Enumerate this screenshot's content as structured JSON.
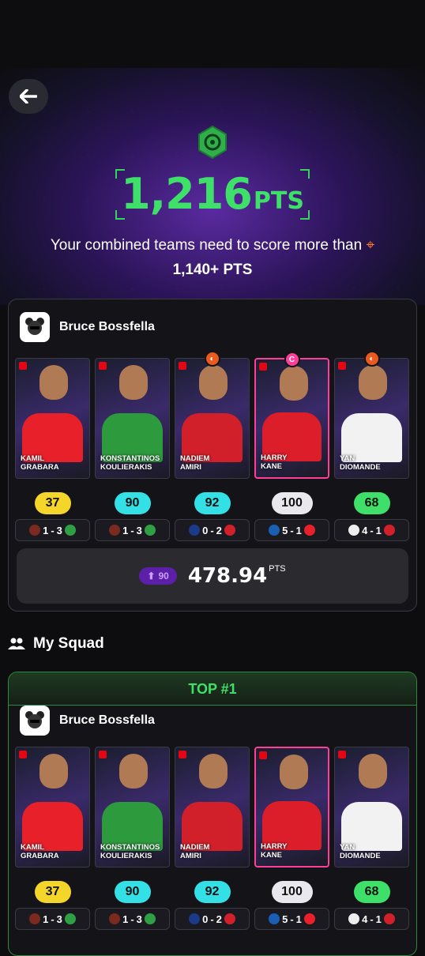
{
  "header": {
    "points_value": "1,216",
    "points_unit": "PTS",
    "need_text": "Your combined teams need to score more than",
    "target": "1,140+ PTS"
  },
  "team1": {
    "owner": "Bruce Bossfella",
    "total_boost": "90",
    "total_points": "478.94",
    "total_unit": "PTS"
  },
  "players": [
    {
      "first": "KAMIL",
      "last": "GRABARA",
      "score": "37",
      "home": "1",
      "away": "3",
      "pill": "#f4d52a",
      "shirt": "#e8202a"
    },
    {
      "first": "KONSTANTINOS",
      "last": "KOULIERAKIS",
      "score": "90",
      "home": "1",
      "away": "3",
      "pill": "#33e0e6",
      "shirt": "#2e9a3e"
    },
    {
      "first": "NADIEM",
      "last": "AMIRI",
      "score": "92",
      "home": "0",
      "away": "2",
      "pill": "#33e0e6",
      "shirt": "#d1202a"
    },
    {
      "first": "HARRY",
      "last": "KANE",
      "score": "100",
      "home": "5",
      "away": "1",
      "pill": "#e8e8ee",
      "shirt": "#dc1d2a"
    },
    {
      "first": "YAN",
      "last": "DIOMANDE",
      "score": "68",
      "home": "4",
      "away": "1",
      "pill": "#3fe06a",
      "shirt": "#f2f2f2"
    }
  ],
  "squad": {
    "title": "My Squad",
    "rank": "TOP #1",
    "owner": "Bruce Bossfella"
  }
}
